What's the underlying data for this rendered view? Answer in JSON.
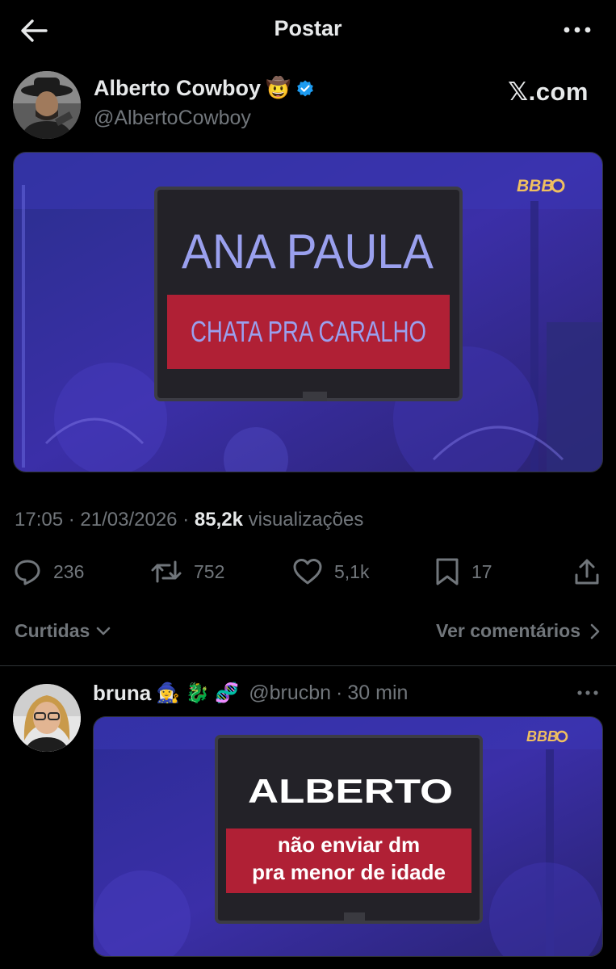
{
  "topbar": {
    "title": "Postar"
  },
  "author": {
    "display_name": "Alberto Cowboy",
    "name_emoji": "🤠",
    "handle": "@AlbertoCowboy",
    "brand": "𝕏.com"
  },
  "post_image": {
    "logo": "BBB",
    "name": "ANA PAULA",
    "caption": "CHATA PRA CARALHO"
  },
  "meta": {
    "time": "17:05",
    "date": "21/03/2026",
    "views_count": "85,2k",
    "views_label": "visualizações"
  },
  "actions": {
    "replies": "236",
    "reposts": "752",
    "likes": "5,1k",
    "bookmarks": "17"
  },
  "footer": {
    "liked_label": "Curtidas",
    "comments_label": "Ver comentários"
  },
  "reply": {
    "name": "bruna",
    "emojis": "🧙‍♀️ 🐉 🧬",
    "handle": "@brucbn",
    "time": "30 min",
    "image": {
      "logo": "BBB",
      "name": "ALBERTO",
      "caption_line1": "não enviar dm",
      "caption_line2": "pra menor de idade"
    }
  },
  "colors": {
    "background": "#000000",
    "text": "#e7e9ea",
    "muted": "#71767b",
    "verified": "#1d9bf0",
    "stage_blue": "#3b2fa8",
    "caption_red": "#b02035"
  }
}
